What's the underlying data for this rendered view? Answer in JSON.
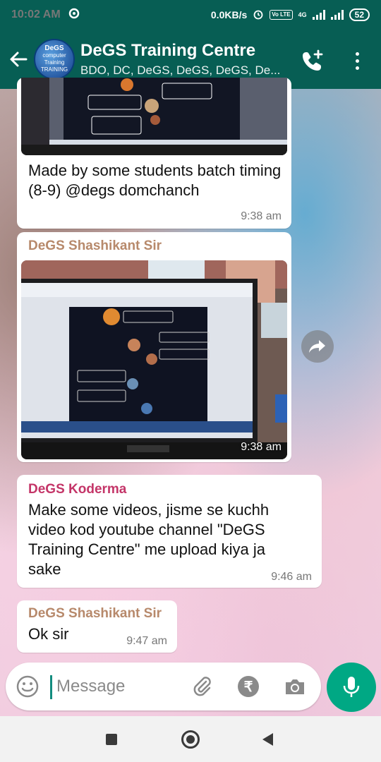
{
  "status_bar": {
    "time": "10:02 AM",
    "net_speed": "0.0KB/s",
    "volte_label": "Vo LTE",
    "network_type": "4G",
    "battery": "52"
  },
  "header": {
    "title": "DeGS Training Centre",
    "subtitle": "BDO, DC, DeGS, DeGS, DeGS, De...",
    "avatar_text": [
      "DeGS",
      "computer",
      "Training",
      "TRAINING"
    ],
    "icons": {
      "back": "arrow-left-icon",
      "call": "add-call-icon",
      "menu": "more-vertical-icon"
    }
  },
  "messages": [
    {
      "type": "image",
      "caption": "Made by some students batch timing (8-9) @degs domchanch",
      "time": "9:38 am"
    },
    {
      "type": "image",
      "sender": "DeGS Shashikant Sir",
      "sender_color": "#b7896b",
      "time": "9:38 am"
    },
    {
      "type": "text",
      "sender": "DeGS Koderma",
      "sender_color": "#c43568",
      "text": "Make some videos, jisme se kuchh video kod youtube channel \"DeGS Training Centre\" me upload kiya ja sake",
      "time": "9:46 am"
    },
    {
      "type": "text",
      "sender": "DeGS Shashikant Sir",
      "sender_color": "#b7896b",
      "text": "Ok sir",
      "time": "9:47 am"
    }
  ],
  "compose": {
    "placeholder": "Message",
    "icons": [
      "emoji-icon",
      "attach-icon",
      "rupee-icon",
      "camera-icon",
      "mic-icon"
    ]
  },
  "colors": {
    "header": "#075e54",
    "accent": "#00a884"
  }
}
